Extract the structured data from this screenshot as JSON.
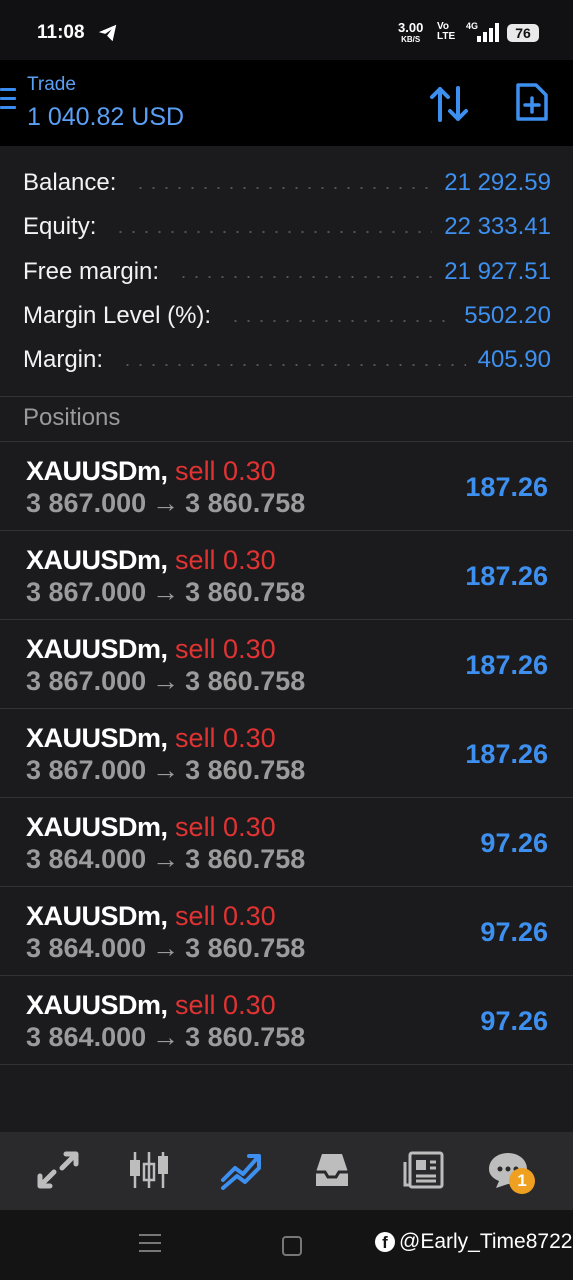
{
  "status_bar": {
    "time": "11:08",
    "net_speed_value": "3.00",
    "net_speed_unit": "KB/S",
    "volte_top": "Vo",
    "volte_bottom": "LTE",
    "network": "4G",
    "battery": "76"
  },
  "header": {
    "title": "Trade",
    "subtitle": "1 040.82 USD"
  },
  "summary": [
    {
      "label": "Balance:",
      "value": "21 292.59"
    },
    {
      "label": "Equity:",
      "value": "22 333.41"
    },
    {
      "label": "Free margin:",
      "value": "21 927.51"
    },
    {
      "label": "Margin Level (%):",
      "value": "5502.20"
    },
    {
      "label": "Margin:",
      "value": "405.90"
    }
  ],
  "positions_title": "Positions",
  "positions": [
    {
      "symbol": "XAUUSDm,",
      "side": "sell 0.30",
      "open": "3 867.000",
      "arrow": "→",
      "current": "3 860.758",
      "profit": "187.26"
    },
    {
      "symbol": "XAUUSDm,",
      "side": "sell 0.30",
      "open": "3 867.000",
      "arrow": "→",
      "current": "3 860.758",
      "profit": "187.26"
    },
    {
      "symbol": "XAUUSDm,",
      "side": "sell 0.30",
      "open": "3 867.000",
      "arrow": "→",
      "current": "3 860.758",
      "profit": "187.26"
    },
    {
      "symbol": "XAUUSDm,",
      "side": "sell 0.30",
      "open": "3 867.000",
      "arrow": "→",
      "current": "3 860.758",
      "profit": "187.26"
    },
    {
      "symbol": "XAUUSDm,",
      "side": "sell 0.30",
      "open": "3 864.000",
      "arrow": "→",
      "current": "3 860.758",
      "profit": "97.26"
    },
    {
      "symbol": "XAUUSDm,",
      "side": "sell 0.30",
      "open": "3 864.000",
      "arrow": "→",
      "current": "3 860.758",
      "profit": "97.26"
    },
    {
      "symbol": "XAUUSDm,",
      "side": "sell 0.30",
      "open": "3 864.000",
      "arrow": "→",
      "current": "3 860.758",
      "profit": "97.26"
    }
  ],
  "bottom_nav": {
    "items": [
      {
        "icon": "quotes-arrows-icon",
        "active": false
      },
      {
        "icon": "chart-candles-icon",
        "active": false
      },
      {
        "icon": "trade-trend-icon",
        "active": true
      },
      {
        "icon": "history-inbox-icon",
        "active": false
      },
      {
        "icon": "news-icon",
        "active": false
      },
      {
        "icon": "messages-icon",
        "active": false
      }
    ],
    "messages_badge": "1"
  },
  "watermark": "@Early_Time8722",
  "colors": {
    "accent": "#3e90f0",
    "sell": "#e23333",
    "background": "#1b1b1d"
  }
}
